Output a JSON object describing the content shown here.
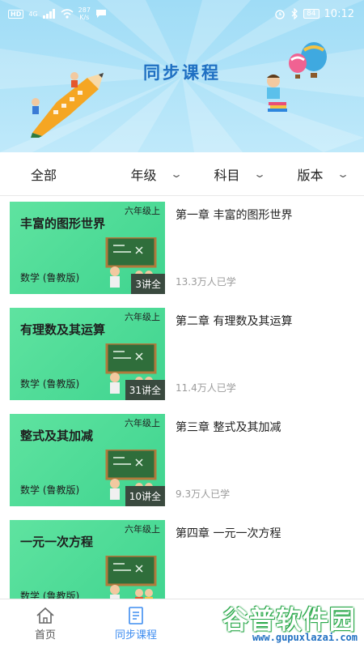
{
  "status_bar": {
    "left_badges": [
      "HD",
      "4G"
    ],
    "speed_value": "287",
    "speed_unit": "K/s",
    "battery": "84",
    "time": "10:12"
  },
  "header": {
    "title": "同步课程"
  },
  "filters": [
    {
      "label": "全部",
      "has_dropdown": false
    },
    {
      "label": "年级",
      "has_dropdown": true
    },
    {
      "label": "科目",
      "has_dropdown": true
    },
    {
      "label": "版本",
      "has_dropdown": true
    }
  ],
  "courses": [
    {
      "thumb_title": "丰富的图形世界",
      "grade": "六年级上",
      "subject": "数学 (鲁教版)",
      "lessons": "3讲全",
      "name": "第一章 丰富的图形世界",
      "learners": "13.3万人已学"
    },
    {
      "thumb_title": "有理数及其运算",
      "grade": "六年级上",
      "subject": "数学 (鲁教版)",
      "lessons": "31讲全",
      "name": "第二章 有理数及其运算",
      "learners": "11.4万人已学"
    },
    {
      "thumb_title": "整式及其加减",
      "grade": "六年级上",
      "subject": "数学 (鲁教版)",
      "lessons": "10讲全",
      "name": "第三章 整式及其加减",
      "learners": "9.3万人已学"
    },
    {
      "thumb_title": "一元一次方程",
      "grade": "六年级上",
      "subject": "数学 (鲁教版)",
      "lessons": "",
      "name": "第四章 一元一次方程",
      "learners": ""
    }
  ],
  "bottom_nav": [
    {
      "label": "首页",
      "icon": "home-icon",
      "active": false
    },
    {
      "label": "同步课程",
      "icon": "document-icon",
      "active": true
    }
  ],
  "watermark": {
    "text": "谷普软件园",
    "url": "www.gupuxlazai.com"
  },
  "colors": {
    "header_bg": "#a8e0f7",
    "title": "#1f6fc2",
    "thumb_green": "#4fdc97",
    "active_nav": "#3f8df0"
  }
}
